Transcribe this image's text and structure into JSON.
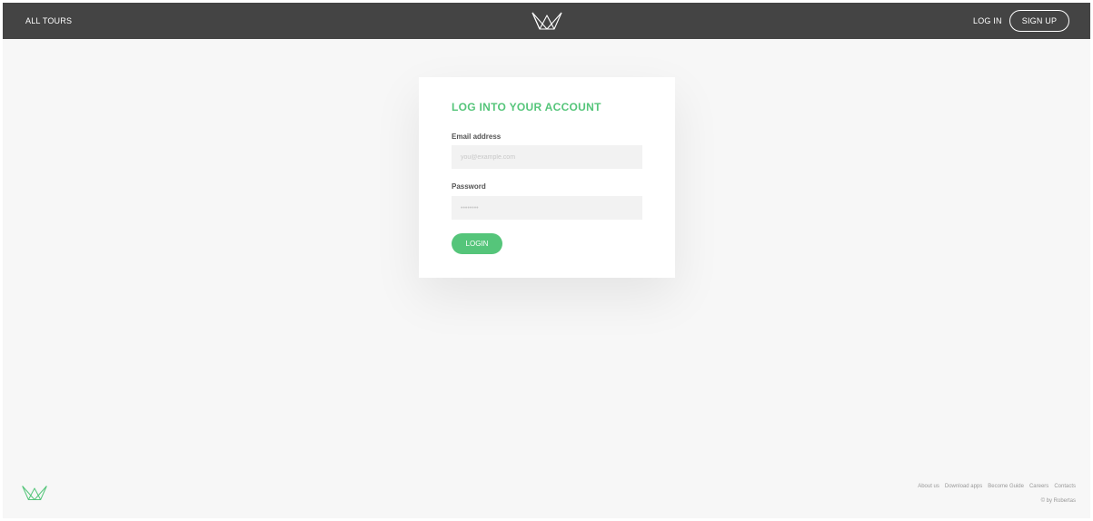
{
  "header": {
    "all_tours": "All Tours",
    "login": "Log in",
    "signup": "Sign up",
    "logo_icon": "crown-logo-icon"
  },
  "login_form": {
    "title": "Log into your account",
    "email_label": "Email address",
    "email_placeholder": "you@example.com",
    "email_value": "",
    "password_label": "Password",
    "password_placeholder": "••••••••",
    "password_value": "",
    "submit_label": "Login"
  },
  "footer": {
    "logo_icon": "crown-logo-icon",
    "links": [
      "About us",
      "Download apps",
      "Become Guide",
      "Careers",
      "Contacts"
    ],
    "copyright": "© by Robertas"
  },
  "colors": {
    "header_bg": "#444444",
    "page_bg": "#f7f7f7",
    "accent": "#55c57a",
    "input_bg": "#f2f2f2"
  }
}
